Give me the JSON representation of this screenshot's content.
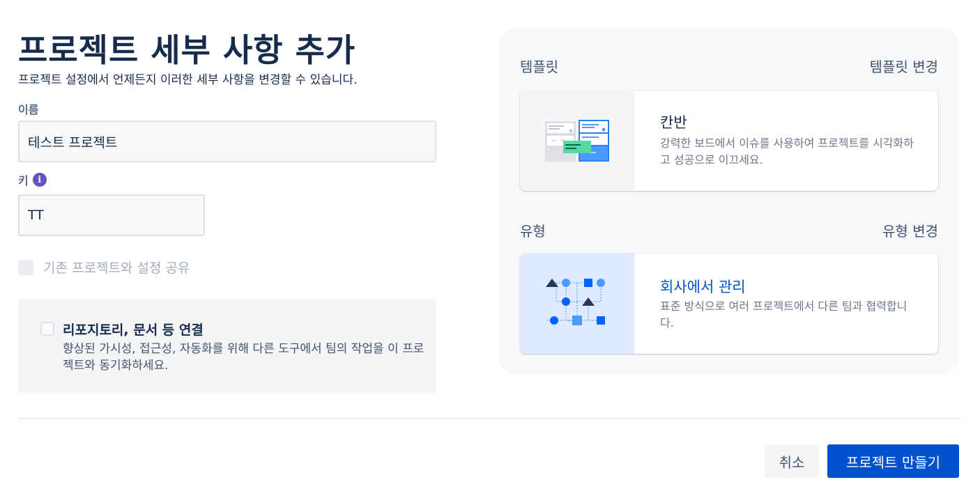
{
  "page": {
    "title": "프로젝트 세부 사항 추가",
    "subtitle": "프로젝트 설정에서 언제든지 이러한 세부 사항을 변경할 수 있습니다."
  },
  "form": {
    "name_label": "이름",
    "name_value": "테스트 프로젝트",
    "key_label": "키",
    "key_info_glyph": "i",
    "key_value": "TT",
    "share_label": "기존 프로젝트와 설정 공유",
    "repo_title": "리포지토리, 문서 등 연결",
    "repo_desc": "향상된 가시성, 접근성, 자동화를 위해 다른 도구에서 팀의 작업을 이 프로젝트와 동기화하세요."
  },
  "template": {
    "heading": "템플릿",
    "change_label": "템플릿 변경",
    "card_title": "칸반",
    "card_desc": "강력한 보드에서 이슈를 사용하여 프로젝트를 시각화하고 성공으로 이끄세요.",
    "icon": "kanban-board-icon"
  },
  "type": {
    "heading": "유형",
    "change_label": "유형 변경",
    "card_title": "회사에서 관리",
    "card_desc": "표준 방식으로 여러 프로젝트에서 다른 팀과 협력합니다.",
    "icon": "company-managed-flow-icon"
  },
  "footer": {
    "cancel_label": "취소",
    "create_label": "프로젝트 만들기"
  },
  "colors": {
    "primary": "#0052cc",
    "text": "#172b4d",
    "info": "#6554c0",
    "kanban_green": "#57d9a3"
  }
}
